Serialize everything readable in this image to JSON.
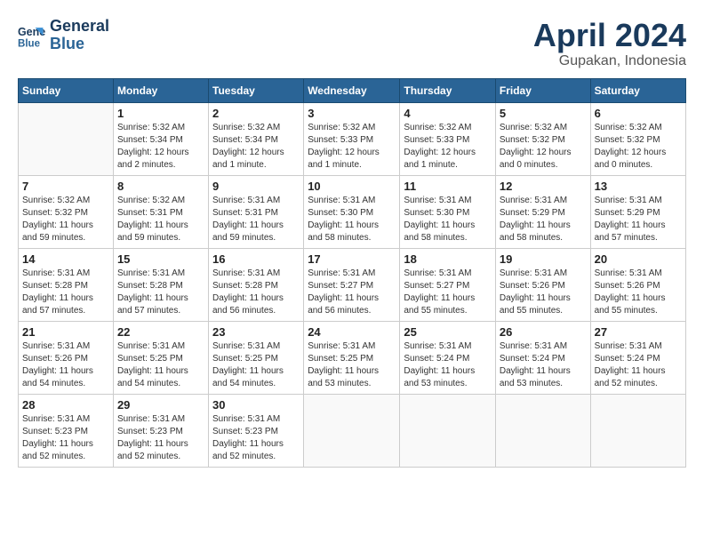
{
  "header": {
    "logo_line1": "General",
    "logo_line2": "Blue",
    "month_year": "April 2024",
    "location": "Gupakan, Indonesia"
  },
  "days_of_week": [
    "Sunday",
    "Monday",
    "Tuesday",
    "Wednesday",
    "Thursday",
    "Friday",
    "Saturday"
  ],
  "weeks": [
    [
      {
        "day": "",
        "sunrise": "",
        "sunset": "",
        "daylight": ""
      },
      {
        "day": "1",
        "sunrise": "Sunrise: 5:32 AM",
        "sunset": "Sunset: 5:34 PM",
        "daylight": "Daylight: 12 hours and 2 minutes."
      },
      {
        "day": "2",
        "sunrise": "Sunrise: 5:32 AM",
        "sunset": "Sunset: 5:34 PM",
        "daylight": "Daylight: 12 hours and 1 minute."
      },
      {
        "day": "3",
        "sunrise": "Sunrise: 5:32 AM",
        "sunset": "Sunset: 5:33 PM",
        "daylight": "Daylight: 12 hours and 1 minute."
      },
      {
        "day": "4",
        "sunrise": "Sunrise: 5:32 AM",
        "sunset": "Sunset: 5:33 PM",
        "daylight": "Daylight: 12 hours and 1 minute."
      },
      {
        "day": "5",
        "sunrise": "Sunrise: 5:32 AM",
        "sunset": "Sunset: 5:32 PM",
        "daylight": "Daylight: 12 hours and 0 minutes."
      },
      {
        "day": "6",
        "sunrise": "Sunrise: 5:32 AM",
        "sunset": "Sunset: 5:32 PM",
        "daylight": "Daylight: 12 hours and 0 minutes."
      }
    ],
    [
      {
        "day": "7",
        "sunrise": "Sunrise: 5:32 AM",
        "sunset": "Sunset: 5:32 PM",
        "daylight": "Daylight: 11 hours and 59 minutes."
      },
      {
        "day": "8",
        "sunrise": "Sunrise: 5:32 AM",
        "sunset": "Sunset: 5:31 PM",
        "daylight": "Daylight: 11 hours and 59 minutes."
      },
      {
        "day": "9",
        "sunrise": "Sunrise: 5:31 AM",
        "sunset": "Sunset: 5:31 PM",
        "daylight": "Daylight: 11 hours and 59 minutes."
      },
      {
        "day": "10",
        "sunrise": "Sunrise: 5:31 AM",
        "sunset": "Sunset: 5:30 PM",
        "daylight": "Daylight: 11 hours and 58 minutes."
      },
      {
        "day": "11",
        "sunrise": "Sunrise: 5:31 AM",
        "sunset": "Sunset: 5:30 PM",
        "daylight": "Daylight: 11 hours and 58 minutes."
      },
      {
        "day": "12",
        "sunrise": "Sunrise: 5:31 AM",
        "sunset": "Sunset: 5:29 PM",
        "daylight": "Daylight: 11 hours and 58 minutes."
      },
      {
        "day": "13",
        "sunrise": "Sunrise: 5:31 AM",
        "sunset": "Sunset: 5:29 PM",
        "daylight": "Daylight: 11 hours and 57 minutes."
      }
    ],
    [
      {
        "day": "14",
        "sunrise": "Sunrise: 5:31 AM",
        "sunset": "Sunset: 5:28 PM",
        "daylight": "Daylight: 11 hours and 57 minutes."
      },
      {
        "day": "15",
        "sunrise": "Sunrise: 5:31 AM",
        "sunset": "Sunset: 5:28 PM",
        "daylight": "Daylight: 11 hours and 57 minutes."
      },
      {
        "day": "16",
        "sunrise": "Sunrise: 5:31 AM",
        "sunset": "Sunset: 5:28 PM",
        "daylight": "Daylight: 11 hours and 56 minutes."
      },
      {
        "day": "17",
        "sunrise": "Sunrise: 5:31 AM",
        "sunset": "Sunset: 5:27 PM",
        "daylight": "Daylight: 11 hours and 56 minutes."
      },
      {
        "day": "18",
        "sunrise": "Sunrise: 5:31 AM",
        "sunset": "Sunset: 5:27 PM",
        "daylight": "Daylight: 11 hours and 55 minutes."
      },
      {
        "day": "19",
        "sunrise": "Sunrise: 5:31 AM",
        "sunset": "Sunset: 5:26 PM",
        "daylight": "Daylight: 11 hours and 55 minutes."
      },
      {
        "day": "20",
        "sunrise": "Sunrise: 5:31 AM",
        "sunset": "Sunset: 5:26 PM",
        "daylight": "Daylight: 11 hours and 55 minutes."
      }
    ],
    [
      {
        "day": "21",
        "sunrise": "Sunrise: 5:31 AM",
        "sunset": "Sunset: 5:26 PM",
        "daylight": "Daylight: 11 hours and 54 minutes."
      },
      {
        "day": "22",
        "sunrise": "Sunrise: 5:31 AM",
        "sunset": "Sunset: 5:25 PM",
        "daylight": "Daylight: 11 hours and 54 minutes."
      },
      {
        "day": "23",
        "sunrise": "Sunrise: 5:31 AM",
        "sunset": "Sunset: 5:25 PM",
        "daylight": "Daylight: 11 hours and 54 minutes."
      },
      {
        "day": "24",
        "sunrise": "Sunrise: 5:31 AM",
        "sunset": "Sunset: 5:25 PM",
        "daylight": "Daylight: 11 hours and 53 minutes."
      },
      {
        "day": "25",
        "sunrise": "Sunrise: 5:31 AM",
        "sunset": "Sunset: 5:24 PM",
        "daylight": "Daylight: 11 hours and 53 minutes."
      },
      {
        "day": "26",
        "sunrise": "Sunrise: 5:31 AM",
        "sunset": "Sunset: 5:24 PM",
        "daylight": "Daylight: 11 hours and 53 minutes."
      },
      {
        "day": "27",
        "sunrise": "Sunrise: 5:31 AM",
        "sunset": "Sunset: 5:24 PM",
        "daylight": "Daylight: 11 hours and 52 minutes."
      }
    ],
    [
      {
        "day": "28",
        "sunrise": "Sunrise: 5:31 AM",
        "sunset": "Sunset: 5:23 PM",
        "daylight": "Daylight: 11 hours and 52 minutes."
      },
      {
        "day": "29",
        "sunrise": "Sunrise: 5:31 AM",
        "sunset": "Sunset: 5:23 PM",
        "daylight": "Daylight: 11 hours and 52 minutes."
      },
      {
        "day": "30",
        "sunrise": "Sunrise: 5:31 AM",
        "sunset": "Sunset: 5:23 PM",
        "daylight": "Daylight: 11 hours and 52 minutes."
      },
      {
        "day": "",
        "sunrise": "",
        "sunset": "",
        "daylight": ""
      },
      {
        "day": "",
        "sunrise": "",
        "sunset": "",
        "daylight": ""
      },
      {
        "day": "",
        "sunrise": "",
        "sunset": "",
        "daylight": ""
      },
      {
        "day": "",
        "sunrise": "",
        "sunset": "",
        "daylight": ""
      }
    ]
  ]
}
